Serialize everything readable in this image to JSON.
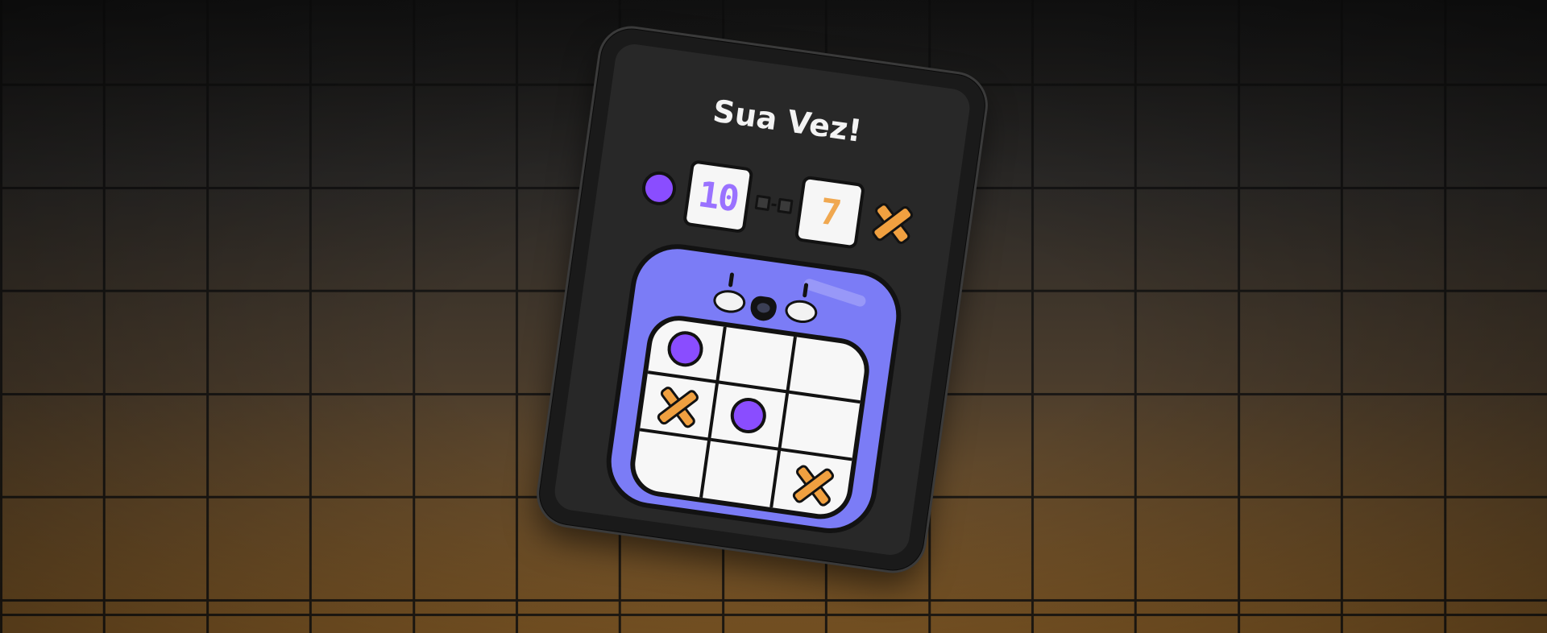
{
  "game": {
    "title": "Sua Vez!",
    "players": {
      "o": {
        "symbol": "O",
        "score": "10",
        "color": "#8a4dff",
        "score_color": "#9a72ff"
      },
      "x": {
        "symbol": "X",
        "score": "7",
        "color": "#f0a040",
        "score_color": "#f0a850"
      }
    },
    "board": {
      "rows": [
        [
          "O",
          "",
          ""
        ],
        [
          "X",
          "O",
          ""
        ],
        [
          "",
          "",
          "X"
        ]
      ]
    }
  },
  "colors": {
    "board_frame": "#7b7cf6",
    "background_top": "#151515",
    "background_bottom": "#8a5f28"
  }
}
